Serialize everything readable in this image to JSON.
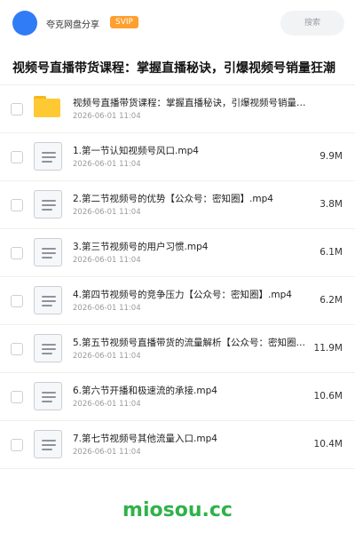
{
  "header": {
    "sharer_name": "夸克网盘分享",
    "svip_badge": "SVIP",
    "search_label": "搜索",
    "accent_color": "#2f7cf6",
    "avatar_icon": "avatar-circle"
  },
  "share": {
    "title": "视频号直播带货课程：掌握直播秘诀，引爆视频号销量狂潮"
  },
  "files": [
    {
      "type": "folder",
      "name": "视频号直播带货课程：掌握直播秘诀，引爆视频号销量狂潮",
      "date": "2026-06-01 11:04",
      "size": ""
    },
    {
      "type": "file",
      "name": "1.第一节认知视频号风口.mp4",
      "date": "2026-06-01 11:04",
      "size": "9.9M"
    },
    {
      "type": "file",
      "name": "2.第二节视频号的优势【公众号：密知圈】.mp4",
      "date": "2026-06-01 11:04",
      "size": "3.8M"
    },
    {
      "type": "file",
      "name": "3.第三节视频号的用户习惯.mp4",
      "date": "2026-06-01 11:04",
      "size": "6.1M"
    },
    {
      "type": "file",
      "name": "4.第四节视频号的竞争压力【公众号：密知圈】.mp4",
      "date": "2026-06-01 11:04",
      "size": "6.2M"
    },
    {
      "type": "file",
      "name": "5.第五节视频号直播带货的流量解析【公众号：密知圈…",
      "date": "2026-06-01 11:04",
      "size": "11.9M"
    },
    {
      "type": "file",
      "name": "6.第六节开播和极速流的承接.mp4",
      "date": "2026-06-01 11:04",
      "size": "10.6M"
    },
    {
      "type": "file",
      "name": "7.第七节视频号其他流量入口.mp4",
      "date": "2026-06-01 11:04",
      "size": "10.4M"
    }
  ],
  "watermark": "miosou.cc"
}
